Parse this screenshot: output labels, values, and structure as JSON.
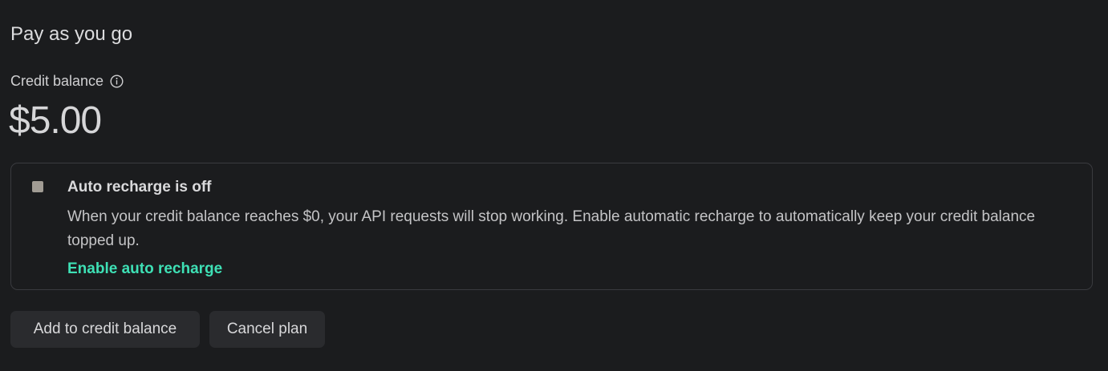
{
  "section": {
    "title": "Pay as you go"
  },
  "balance": {
    "label": "Credit balance",
    "info_icon": "info-circle-icon",
    "amount": "$5.00"
  },
  "auto_recharge": {
    "status_indicator": "square-status-icon",
    "status_color": "#a19c94",
    "title": "Auto recharge is off",
    "description": "When your credit balance reaches $0, your API requests will stop working. Enable automatic recharge to automatically keep your credit balance topped up.",
    "enable_link": "Enable auto recharge",
    "link_color": "#3ee0b5"
  },
  "actions": {
    "add_label": "Add to credit balance",
    "cancel_label": "Cancel plan"
  }
}
